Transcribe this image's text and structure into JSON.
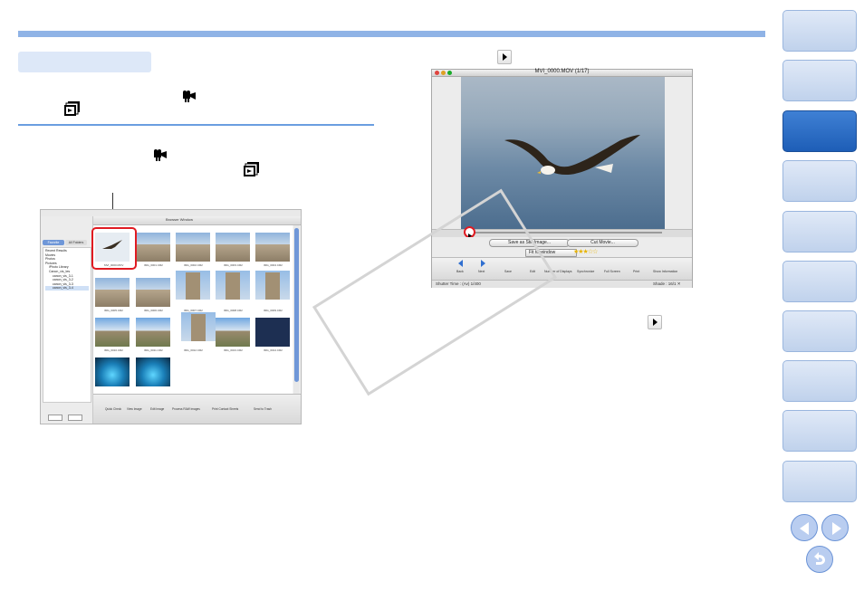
{
  "player": {
    "title": "MVI_0000.MOV (1/17)",
    "save_still_button": "Save as Still Image...",
    "cut_movie_button": "Cut Movie...",
    "fit_option": "Fit to window",
    "status_left": "Shutter Time : (Av) 1/400",
    "status_right": "Shade : 16/1 ✕",
    "tools": [
      "Back",
      "Next",
      "Save",
      "Edit",
      "Number of Displays",
      "Synchronize",
      "Full Screen",
      "Print",
      "Show Information"
    ]
  },
  "browser": {
    "window_title": "Browser Window",
    "tabs": [
      "Favorite Folders",
      "All Folders"
    ],
    "tree": [
      "Recent Results",
      "Movies",
      "Photos",
      "Pictures",
      "iPhoto Library",
      "Canon_vis_tes",
      "canon_vis_3-1",
      "canon_vis_3-2",
      "canon_vis_3-3",
      "canon_vis_3-4"
    ],
    "captions": [
      "MVI_0000.MOV",
      "IMG_0001.CR2",
      "IMG_0002.CR2",
      "IMG_0003.CR2",
      "IMG_0004.CR2",
      "IMG_0005.CR2",
      "IMG_0006.CR2",
      "IMG_0007.CR2",
      "IMG_0008.CR2",
      "IMG_0009.CR2",
      "IMG_0010.CR2",
      "IMG_0011.CR2",
      "IMG_0012.CR2",
      "IMG_0013.CR2",
      "IMG_0014.CR2"
    ],
    "bottom_tools": [
      "Quick Check",
      "View Image",
      "Edit Image",
      "Process RAW images",
      "Print Contact Sheets",
      "Send to Trash"
    ]
  },
  "colors": {
    "accent_bar": "#8fb3e6",
    "highlight": "#e01b22",
    "sidebar_active": "#2a6cc4"
  },
  "icons": [
    "movie-camera-icon",
    "movie-stack-icon",
    "play-icon"
  ]
}
